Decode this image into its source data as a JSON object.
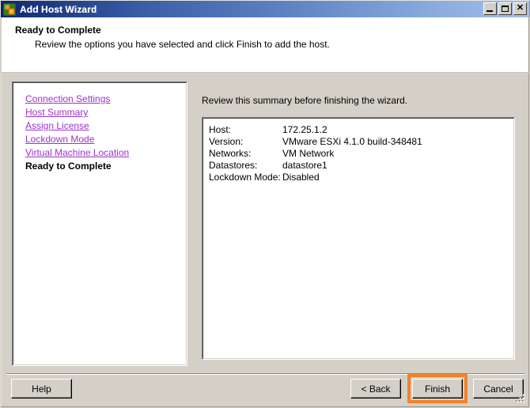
{
  "window": {
    "title": "Add Host Wizard",
    "icon": "vsphere-host-icon",
    "controls": {
      "minimize": "minimize-icon",
      "maximize": "maximize-icon",
      "close": "close-icon"
    }
  },
  "header": {
    "title": "Ready to Complete",
    "subtitle": "Review the options you have selected and click Finish to add the host."
  },
  "sidebar": {
    "items": [
      {
        "label": "Connection Settings",
        "state": "link"
      },
      {
        "label": "Host Summary",
        "state": "link"
      },
      {
        "label": "Assign License",
        "state": "link"
      },
      {
        "label": "Lockdown Mode",
        "state": "link"
      },
      {
        "label": "Virtual Machine Location",
        "state": "link"
      },
      {
        "label": "Ready to Complete",
        "state": "current"
      }
    ],
    "link_color": "#9933cc",
    "current_color": "#000000"
  },
  "content": {
    "intro": "Review this summary before finishing the wizard.",
    "summary": [
      {
        "label": "Host:",
        "value": "172.25.1.2"
      },
      {
        "label": "Version:",
        "value": "VMware ESXi 4.1.0 build-348481"
      },
      {
        "label": "Networks:",
        "value": "VM Network"
      },
      {
        "label": "Datastores:",
        "value": "datastore1"
      },
      {
        "label": "Lockdown Mode:",
        "value": "Disabled"
      }
    ]
  },
  "footer": {
    "help_label": "Help",
    "back_label": "< Back",
    "finish_label": "Finish",
    "cancel_label": "Cancel",
    "highlight_color": "#f4812c",
    "highlighted_button": "Finish"
  }
}
